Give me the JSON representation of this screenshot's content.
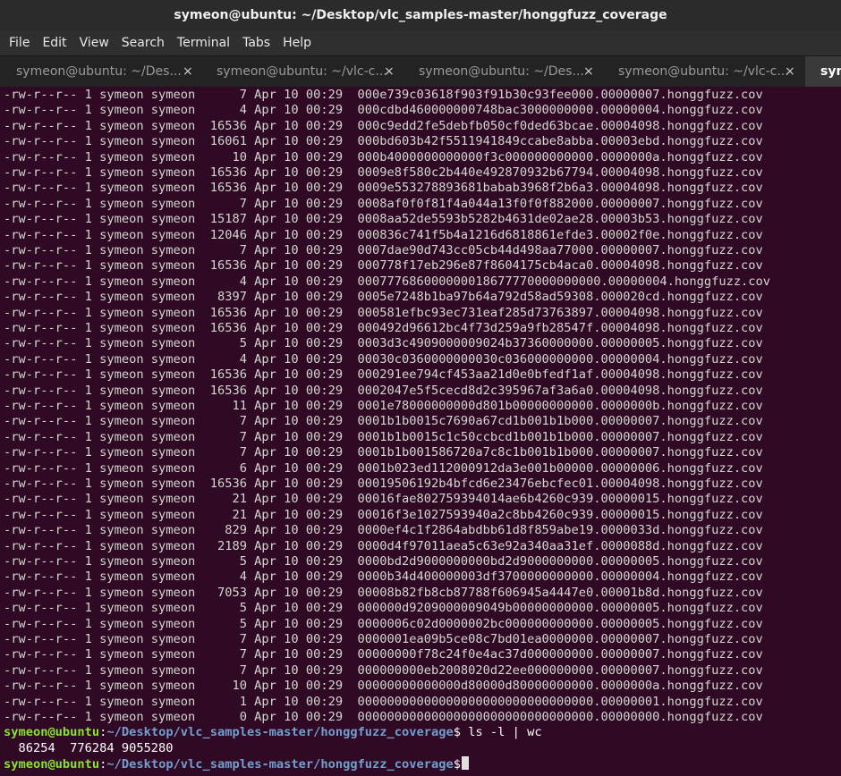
{
  "window": {
    "title": "symeon@ubuntu: ~/Desktop/vlc_samples-master/honggfuzz_coverage"
  },
  "menu": [
    "File",
    "Edit",
    "View",
    "Search",
    "Terminal",
    "Tabs",
    "Help"
  ],
  "tabs": [
    {
      "label": "symeon@ubuntu: ~/Des...",
      "close": "×",
      "active": false
    },
    {
      "label": "symeon@ubuntu: ~/vlc-c...",
      "close": "×",
      "active": false
    },
    {
      "label": "symeon@ubuntu: ~/Des...",
      "close": "×",
      "active": false
    },
    {
      "label": "symeon@ubuntu: ~/vlc-c...",
      "close": "×",
      "active": false
    },
    {
      "label": "sym",
      "close": "",
      "active": true
    }
  ],
  "listing": [
    {
      "perms": "-rw-r--r--",
      "links": "1",
      "owner": "symeon",
      "group": "symeon",
      "size": "7",
      "date": "Apr 10 00:29",
      "name": "000e739c03618f903f91b30c93fee000.00000007.honggfuzz.cov"
    },
    {
      "perms": "-rw-r--r--",
      "links": "1",
      "owner": "symeon",
      "group": "symeon",
      "size": "4",
      "date": "Apr 10 00:29",
      "name": "000cdbd460000000748bac3000000000.00000004.honggfuzz.cov"
    },
    {
      "perms": "-rw-r--r--",
      "links": "1",
      "owner": "symeon",
      "group": "symeon",
      "size": "16536",
      "date": "Apr 10 00:29",
      "name": "000c9edd2fe5debfb050cf0ded63bcae.00004098.honggfuzz.cov"
    },
    {
      "perms": "-rw-r--r--",
      "links": "1",
      "owner": "symeon",
      "group": "symeon",
      "size": "16061",
      "date": "Apr 10 00:29",
      "name": "000bd603b42f5511941849ccabe8abba.00003ebd.honggfuzz.cov"
    },
    {
      "perms": "-rw-r--r--",
      "links": "1",
      "owner": "symeon",
      "group": "symeon",
      "size": "10",
      "date": "Apr 10 00:29",
      "name": "000b4000000000000f3c000000000000.0000000a.honggfuzz.cov"
    },
    {
      "perms": "-rw-r--r--",
      "links": "1",
      "owner": "symeon",
      "group": "symeon",
      "size": "16536",
      "date": "Apr 10 00:29",
      "name": "0009e8f580c2b440e492870932b67794.00004098.honggfuzz.cov"
    },
    {
      "perms": "-rw-r--r--",
      "links": "1",
      "owner": "symeon",
      "group": "symeon",
      "size": "16536",
      "date": "Apr 10 00:29",
      "name": "0009e553278893681babab3968f2b6a3.00004098.honggfuzz.cov"
    },
    {
      "perms": "-rw-r--r--",
      "links": "1",
      "owner": "symeon",
      "group": "symeon",
      "size": "7",
      "date": "Apr 10 00:29",
      "name": "0008af0f0f81f4a044a13f0f0f882000.00000007.honggfuzz.cov"
    },
    {
      "perms": "-rw-r--r--",
      "links": "1",
      "owner": "symeon",
      "group": "symeon",
      "size": "15187",
      "date": "Apr 10 00:29",
      "name": "0008aa52de5593b5282b4631de02ae28.00003b53.honggfuzz.cov"
    },
    {
      "perms": "-rw-r--r--",
      "links": "1",
      "owner": "symeon",
      "group": "symeon",
      "size": "12046",
      "date": "Apr 10 00:29",
      "name": "000836c741f5b4a1216d6818861efde3.00002f0e.honggfuzz.cov"
    },
    {
      "perms": "-rw-r--r--",
      "links": "1",
      "owner": "symeon",
      "group": "symeon",
      "size": "7",
      "date": "Apr 10 00:29",
      "name": "0007dae90d743cc05cb44d498aa77000.00000007.honggfuzz.cov"
    },
    {
      "perms": "-rw-r--r--",
      "links": "1",
      "owner": "symeon",
      "group": "symeon",
      "size": "16536",
      "date": "Apr 10 00:29",
      "name": "000778f17eb296e87f8604175cb4aca0.00004098.honggfuzz.cov"
    },
    {
      "perms": "-rw-r--r--",
      "links": "1",
      "owner": "symeon",
      "group": "symeon",
      "size": "4",
      "date": "Apr 10 00:29",
      "name": "000777686000000018677770000000000.00000004.honggfuzz.cov"
    },
    {
      "perms": "-rw-r--r--",
      "links": "1",
      "owner": "symeon",
      "group": "symeon",
      "size": "8397",
      "date": "Apr 10 00:29",
      "name": "0005e7248b1ba97b64a792d58ad59308.000020cd.honggfuzz.cov"
    },
    {
      "perms": "-rw-r--r--",
      "links": "1",
      "owner": "symeon",
      "group": "symeon",
      "size": "16536",
      "date": "Apr 10 00:29",
      "name": "000581efbc93ec731eaf285d73763897.00004098.honggfuzz.cov"
    },
    {
      "perms": "-rw-r--r--",
      "links": "1",
      "owner": "symeon",
      "group": "symeon",
      "size": "16536",
      "date": "Apr 10 00:29",
      "name": "000492d96612bc4f73d259a9fb28547f.00004098.honggfuzz.cov"
    },
    {
      "perms": "-rw-r--r--",
      "links": "1",
      "owner": "symeon",
      "group": "symeon",
      "size": "5",
      "date": "Apr 10 00:29",
      "name": "0003d3c4909000009024b37360000000.00000005.honggfuzz.cov"
    },
    {
      "perms": "-rw-r--r--",
      "links": "1",
      "owner": "symeon",
      "group": "symeon",
      "size": "4",
      "date": "Apr 10 00:29",
      "name": "00030c0360000000030c036000000000.00000004.honggfuzz.cov"
    },
    {
      "perms": "-rw-r--r--",
      "links": "1",
      "owner": "symeon",
      "group": "symeon",
      "size": "16536",
      "date": "Apr 10 00:29",
      "name": "000291ee794cf453aa21d0e0bfedf1af.00004098.honggfuzz.cov"
    },
    {
      "perms": "-rw-r--r--",
      "links": "1",
      "owner": "symeon",
      "group": "symeon",
      "size": "16536",
      "date": "Apr 10 00:29",
      "name": "0002047e5f5cecd8d2c395967af3a6a0.00004098.honggfuzz.cov"
    },
    {
      "perms": "-rw-r--r--",
      "links": "1",
      "owner": "symeon",
      "group": "symeon",
      "size": "11",
      "date": "Apr 10 00:29",
      "name": "0001e78000000000d801b00000000000.0000000b.honggfuzz.cov"
    },
    {
      "perms": "-rw-r--r--",
      "links": "1",
      "owner": "symeon",
      "group": "symeon",
      "size": "7",
      "date": "Apr 10 00:29",
      "name": "0001b1b0015c7690a67cd1b001b1b000.00000007.honggfuzz.cov"
    },
    {
      "perms": "-rw-r--r--",
      "links": "1",
      "owner": "symeon",
      "group": "symeon",
      "size": "7",
      "date": "Apr 10 00:29",
      "name": "0001b1b0015c1c50ccbcd1b001b1b000.00000007.honggfuzz.cov"
    },
    {
      "perms": "-rw-r--r--",
      "links": "1",
      "owner": "symeon",
      "group": "symeon",
      "size": "7",
      "date": "Apr 10 00:29",
      "name": "0001b1b001586720a7c8c1b001b1b000.00000007.honggfuzz.cov"
    },
    {
      "perms": "-rw-r--r--",
      "links": "1",
      "owner": "symeon",
      "group": "symeon",
      "size": "6",
      "date": "Apr 10 00:29",
      "name": "0001b023ed112000912da3e001b00000.00000006.honggfuzz.cov"
    },
    {
      "perms": "-rw-r--r--",
      "links": "1",
      "owner": "symeon",
      "group": "symeon",
      "size": "16536",
      "date": "Apr 10 00:29",
      "name": "00019506192b4bfcd6e23476ebcfec01.00004098.honggfuzz.cov"
    },
    {
      "perms": "-rw-r--r--",
      "links": "1",
      "owner": "symeon",
      "group": "symeon",
      "size": "21",
      "date": "Apr 10 00:29",
      "name": "00016fae802759394014ae6b4260c939.00000015.honggfuzz.cov"
    },
    {
      "perms": "-rw-r--r--",
      "links": "1",
      "owner": "symeon",
      "group": "symeon",
      "size": "21",
      "date": "Apr 10 00:29",
      "name": "00016f3e1027593940a2c8bb4260c939.00000015.honggfuzz.cov"
    },
    {
      "perms": "-rw-r--r--",
      "links": "1",
      "owner": "symeon",
      "group": "symeon",
      "size": "829",
      "date": "Apr 10 00:29",
      "name": "0000ef4c1f2864abdbb61d8f859abe19.0000033d.honggfuzz.cov"
    },
    {
      "perms": "-rw-r--r--",
      "links": "1",
      "owner": "symeon",
      "group": "symeon",
      "size": "2189",
      "date": "Apr 10 00:29",
      "name": "0000d4f97011aea5c63e92a340aa31ef.0000088d.honggfuzz.cov"
    },
    {
      "perms": "-rw-r--r--",
      "links": "1",
      "owner": "symeon",
      "group": "symeon",
      "size": "5",
      "date": "Apr 10 00:29",
      "name": "0000bd2d9000000000bd2d9000000000.00000005.honggfuzz.cov"
    },
    {
      "perms": "-rw-r--r--",
      "links": "1",
      "owner": "symeon",
      "group": "symeon",
      "size": "4",
      "date": "Apr 10 00:29",
      "name": "0000b34d400000003df3700000000000.00000004.honggfuzz.cov"
    },
    {
      "perms": "-rw-r--r--",
      "links": "1",
      "owner": "symeon",
      "group": "symeon",
      "size": "7053",
      "date": "Apr 10 00:29",
      "name": "00008b82fb8cb87788f606945a4447e0.00001b8d.honggfuzz.cov"
    },
    {
      "perms": "-rw-r--r--",
      "links": "1",
      "owner": "symeon",
      "group": "symeon",
      "size": "5",
      "date": "Apr 10 00:29",
      "name": "000000d9209000009049b00000000000.00000005.honggfuzz.cov"
    },
    {
      "perms": "-rw-r--r--",
      "links": "1",
      "owner": "symeon",
      "group": "symeon",
      "size": "5",
      "date": "Apr 10 00:29",
      "name": "0000006c02d0000002bc000000000000.00000005.honggfuzz.cov"
    },
    {
      "perms": "-rw-r--r--",
      "links": "1",
      "owner": "symeon",
      "group": "symeon",
      "size": "7",
      "date": "Apr 10 00:29",
      "name": "0000001ea09b5ce08c7bd01ea0000000.00000007.honggfuzz.cov"
    },
    {
      "perms": "-rw-r--r--",
      "links": "1",
      "owner": "symeon",
      "group": "symeon",
      "size": "7",
      "date": "Apr 10 00:29",
      "name": "00000000f78c24f0e4ac37d000000000.00000007.honggfuzz.cov"
    },
    {
      "perms": "-rw-r--r--",
      "links": "1",
      "owner": "symeon",
      "group": "symeon",
      "size": "7",
      "date": "Apr 10 00:29",
      "name": "000000000eb2008020d22ee000000000.00000007.honggfuzz.cov"
    },
    {
      "perms": "-rw-r--r--",
      "links": "1",
      "owner": "symeon",
      "group": "symeon",
      "size": "10",
      "date": "Apr 10 00:29",
      "name": "00000000000000d80000d80000000000.0000000a.honggfuzz.cov"
    },
    {
      "perms": "-rw-r--r--",
      "links": "1",
      "owner": "symeon",
      "group": "symeon",
      "size": "1",
      "date": "Apr 10 00:29",
      "name": "00000000000000000000000000000000.00000001.honggfuzz.cov"
    },
    {
      "perms": "-rw-r--r--",
      "links": "1",
      "owner": "symeon",
      "group": "symeon",
      "size": "0",
      "date": "Apr 10 00:29",
      "name": "00000000000000000000000000000000.00000000.honggfuzz.cov"
    }
  ],
  "prompt": {
    "user": "symeon@ubuntu",
    "sep": ":",
    "path": "~/Desktop/vlc_samples-master/honggfuzz_coverage",
    "dollar": "$"
  },
  "command": " ls -l | wc",
  "output": "  86254  776284 9055280",
  "colors": {
    "background": "#300a24",
    "text": "#d3d7cf",
    "prompt_user": "#8ae234",
    "prompt_path": "#729fcf"
  }
}
